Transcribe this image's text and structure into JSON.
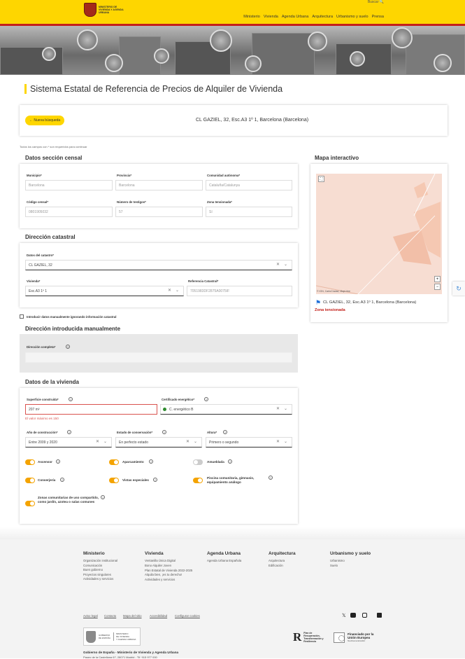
{
  "header": {
    "logo_text": "MINISTERIO DE VIVIENDA Y AGENDA URBANA",
    "search_label": "Buscar",
    "nav": [
      "Ministerio",
      "Vivienda",
      "Agenda Urbana",
      "Arquitectura",
      "Urbanismo y suelo",
      "Prensa"
    ]
  },
  "page_title": "Sistema Estatal de Referencia de Precios de Alquiler de Vivienda",
  "search_bar": {
    "new_search": "Nueva búsqueda",
    "address": "CL GAZIEL, 32, Esc.A3 1º 1, Barcelona (Barcelona)"
  },
  "required_note": "Todos los campos con * son requeridos para continuar",
  "censal": {
    "title": "Datos sección censal",
    "municipio_label": "Municipio*",
    "municipio": "Barcelona",
    "provincia_label": "Provincia*",
    "provincia": "Barcelona",
    "comunidad_label": "Comunidad autónoma*",
    "comunidad": "Cataluña/Catalunya",
    "codigo_label": "Código censal*",
    "codigo": "0801905032",
    "testigos_label": "Número de testigos*",
    "testigos": "57",
    "zona_label": "Zona tensionada*",
    "zona": "Sí"
  },
  "catastral": {
    "title": "Dirección catastral",
    "catastro_label": "Datos del catastro*",
    "catastro": "CL GAZIEL, 32",
    "vivienda_label": "Vivienda*",
    "vivienda": "Esc.A3 1º 1",
    "ref_label": "Referencia Catastral*",
    "ref": "7051983DF2875A0075IF"
  },
  "manual_checkbox": "Introducir datos manualmente ignorando información catastral",
  "manual": {
    "title": "Dirección introducida manualmente",
    "dir_label": "Dirección completa*"
  },
  "vivienda": {
    "title": "Datos de la vivienda",
    "superficie_label": "Superficie construida*",
    "superficie": "207 m²",
    "superficie_error": "El valor máximo es 150",
    "cert_label": "Certificado energético*",
    "cert": "C. energético B",
    "anio_label": "Año de construcción*",
    "anio": "Entre 2009 y 2020",
    "estado_label": "Estado de conservación*",
    "estado": "En perfecto estado",
    "altura_label": "Altura*",
    "altura": "Primero o segundo",
    "toggles": [
      "Ascensor",
      "Aparcamiento",
      "Amueblada",
      "Conserjería",
      "Vistas especiales",
      "Piscina comunitaria, gimnasio, equipamiento análogo",
      "Zonas comunitarias de uso compartido, como jardín, azotea o salas comunes"
    ]
  },
  "map": {
    "title": "Mapa interactivo",
    "attribution": "© IGN, CartoCiudad, MapLibre",
    "address": "CL GAZIEL, 32, Esc.A3 1º 1, Barcelona (Barcelona)",
    "zona": "Zona tensionada"
  },
  "footer": {
    "cols": [
      {
        "title": "Ministerio",
        "items": [
          "Organización institucional",
          "Comunicación",
          "Buen gobierno",
          "Proyectos singulares",
          "Actividades y servicios"
        ]
      },
      {
        "title": "Vivienda",
        "items": [
          "Ventanilla Única Digital",
          "Bono Alquiler Joven",
          "Plan Estatal de Vivienda 2022-2025",
          "Alquila bien, ¡es tu derecho!",
          "Actividades y servicios"
        ]
      },
      {
        "title": "Agenda Urbana",
        "items": [
          "Agenda Urbana Española"
        ]
      },
      {
        "title": "Arquitectura",
        "items": [
          "Arquitectura",
          "Edificación"
        ]
      },
      {
        "title": "Urbanismo y suelo",
        "items": [
          "Urbanismo",
          "Suelo"
        ]
      }
    ],
    "links": [
      "Aviso legal",
      "Contacto",
      "Mapa del sitio",
      "Accesibilidad",
      "Configurar cookies"
    ],
    "gob": "Gobierno de España - Ministerio de Vivienda y Agenda Urbana",
    "addr": "Paseo de la Castellana 67, 28071 Madrid - Tlf. 915 977 000",
    "plan": "Plan de Recuperación, Transformación y Resiliencia",
    "eu": "Financiado por la Unión Europea",
    "eu_sub": "NextGenerationEU"
  },
  "colors": {
    "yellow": "#fed600",
    "red": "#c3211b",
    "orange": "#f4a300"
  }
}
